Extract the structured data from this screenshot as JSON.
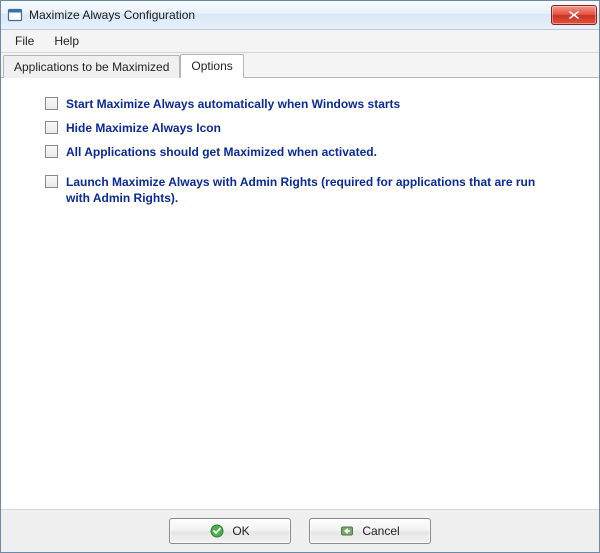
{
  "window": {
    "title": "Maximize Always Configuration"
  },
  "menubar": {
    "file": "File",
    "help": "Help"
  },
  "tabs": {
    "applications": "Applications to be Maximized",
    "options": "Options",
    "active": "options"
  },
  "options": {
    "start_with_windows": "Start Maximize Always automatically when Windows starts",
    "hide_icon": "Hide Maximize Always Icon",
    "maximize_all": "All Applications should get Maximized when activated.",
    "admin_rights": "Launch Maximize Always with Admin Rights (required for applications that are run with Admin Rights)."
  },
  "buttons": {
    "ok": "OK",
    "cancel": "Cancel"
  }
}
